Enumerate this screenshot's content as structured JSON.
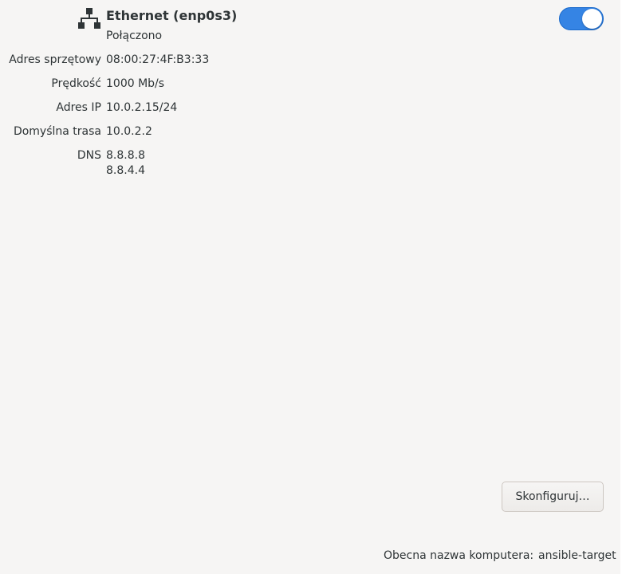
{
  "connection": {
    "name": "Ethernet (enp0s3)",
    "status": "Połączono",
    "icon": "wired-network-icon",
    "enabled": true
  },
  "details": {
    "hardware_address": {
      "label": "Adres sprzętowy",
      "value": "08:00:27:4F:B3:33"
    },
    "speed": {
      "label": "Prędkość",
      "value": "1000 Mb/s"
    },
    "ip_address": {
      "label": "Adres IP",
      "value": "10.0.2.15/24"
    },
    "default_route": {
      "label": "Domyślna trasa",
      "value": "10.0.2.2"
    },
    "dns": {
      "label": "DNS",
      "values": [
        "8.8.8.8",
        "8.8.4.4"
      ]
    }
  },
  "actions": {
    "configure_label": "Skonfiguruj…"
  },
  "footer": {
    "hostname_label": "Obecna nazwa komputera:",
    "hostname_value": "ansible-target"
  },
  "colors": {
    "background": "#f6f5f4",
    "accent": "#3584e4",
    "text": "#2e3436"
  }
}
